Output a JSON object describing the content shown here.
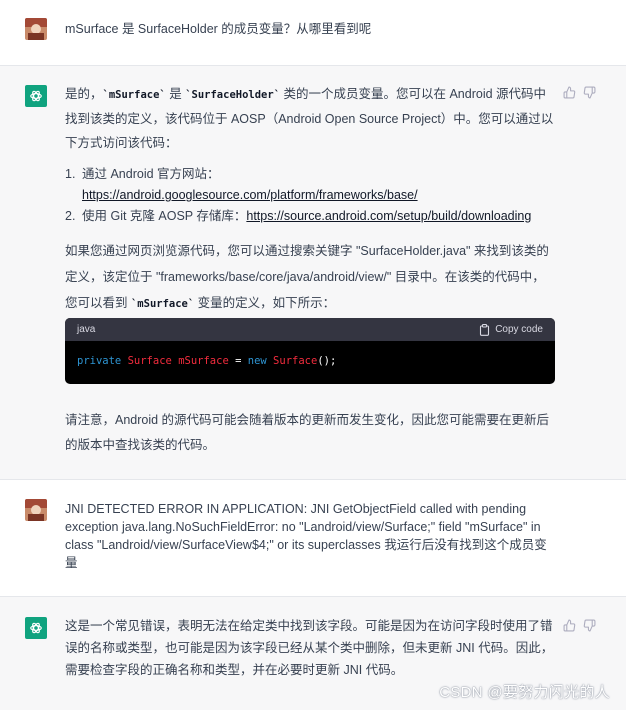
{
  "messages": {
    "q1": "mSurface 是 SurfaceHolder 的成员变量？从哪里看到呢",
    "a1": {
      "intro_pre": "是的，",
      "intro_code1": "`mSurface`",
      "intro_mid": " 是 ",
      "intro_code2": "`SurfaceHolder`",
      "intro_post": " 类的一个成员变量。您可以在 Android 源代码中找到该类的定义，该代码位于 AOSP（Android Open Source Project）中。您可以通过以下方式访问该代码：",
      "steps": [
        {
          "num": "1.",
          "text": "通过 Android 官方网站：",
          "link": "https://android.googlesource.com/platform/frameworks/base/"
        },
        {
          "num": "2.",
          "text": "使用 Git 克隆 AOSP 存储库：",
          "link": "https://source.android.com/setup/build/downloading"
        }
      ],
      "para2_pre": "如果您通过网页浏览源代码，您可以通过搜索关键字 \"SurfaceHolder.java\" 来找到该类的定义，该定位于 \"frameworks/base/core/java/android/view/\" 目录中。在该类的代码中，您可以看到 ",
      "para2_code": "`mSurface`",
      "para2_post": " 变量的定义，如下所示：",
      "code": {
        "language": "java",
        "copy_label": "Copy code",
        "kw1": "private",
        "type1": "Surface",
        "name": "mSurface",
        "op": "=",
        "kw2": "new",
        "type2": "Surface",
        "tail": "();"
      },
      "para3": "请注意，Android 的源代码可能会随着版本的更新而发生变化，因此您可能需要在更新后的版本中查找该类的代码。"
    },
    "q2": "JNI DETECTED ERROR IN APPLICATION: JNI GetObjectField called with pending exception java.lang.NoSuchFieldError: no \"Landroid/view/Surface;\" field \"mSurface\" in class \"Landroid/view/SurfaceView$4;\" or its superclasses 我运行后没有找到这个成员变量",
    "a2": "这是一个常见错误，表明无法在给定类中找到该字段。可能是因为在访问字段时使用了错误的名称或类型，也可能是因为该字段已经从某个类中删除，但未更新 JNI 代码。因此，需要检查字段的正确名称和类型，并在必要时更新 JNI 代码。"
  },
  "watermark": "CSDN @要努力闪光的人",
  "icons": {
    "user_avatar": "user-avatar-photo",
    "bot_avatar": "openai-logo-icon",
    "thumbs_up": "thumbs-up-icon",
    "thumbs_down": "thumbs-down-icon",
    "copy": "clipboard-icon"
  },
  "colors": {
    "bot_bg": "#f7f7f8",
    "bot_accent": "#10a37f",
    "code_bg": "#000000",
    "code_header": "#343541"
  }
}
